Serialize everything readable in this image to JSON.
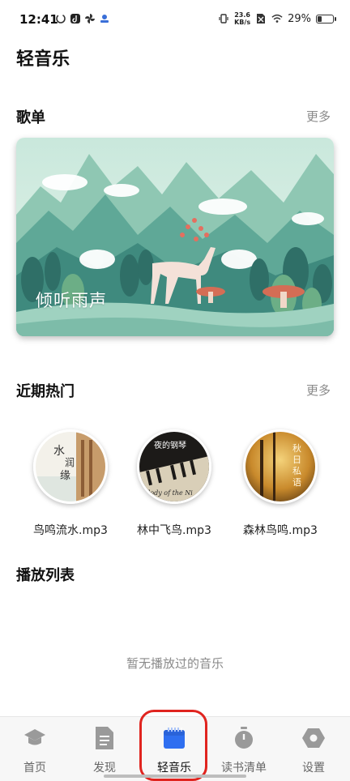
{
  "status_bar": {
    "time": "12:41",
    "net_speed_value": "23.6",
    "net_speed_unit": "KB/s",
    "battery": "29%",
    "battery_level": 0.29,
    "icons": [
      "sync-icon",
      "tiktok-icon",
      "pinwheel-icon",
      "notification-app-icon",
      "vibrate-icon",
      "sim-off-icon",
      "wifi-icon",
      "battery-icon"
    ]
  },
  "header": {
    "title": "轻音乐"
  },
  "playlist_section": {
    "title": "歌单",
    "more": "更多",
    "banner_caption": "倾听雨声"
  },
  "hot_section": {
    "title": "近期热门",
    "more": "更多",
    "items": [
      {
        "name": "鸟鸣流水.mp3",
        "cover_text": "水 润 缘"
      },
      {
        "name": "林中飞鸟.mp3",
        "cover_text": "夜的钢琴",
        "cover_subtext": "elody of the Ni"
      },
      {
        "name": "森林鸟鸣.mp3",
        "cover_text": "秋日私语"
      }
    ]
  },
  "play_list_section": {
    "title": "播放列表",
    "empty_text": "暂无播放过的音乐"
  },
  "bottom_nav": {
    "active_color": "#2f6ff0",
    "items": [
      {
        "label": "首页",
        "icon": "graduation-cap-icon"
      },
      {
        "label": "发现",
        "icon": "document-icon"
      },
      {
        "label": "轻音乐",
        "icon": "calendar-icon",
        "active": true
      },
      {
        "label": "读书清单",
        "icon": "stopwatch-icon"
      },
      {
        "label": "设置",
        "icon": "settings-hexagon-icon"
      }
    ]
  }
}
